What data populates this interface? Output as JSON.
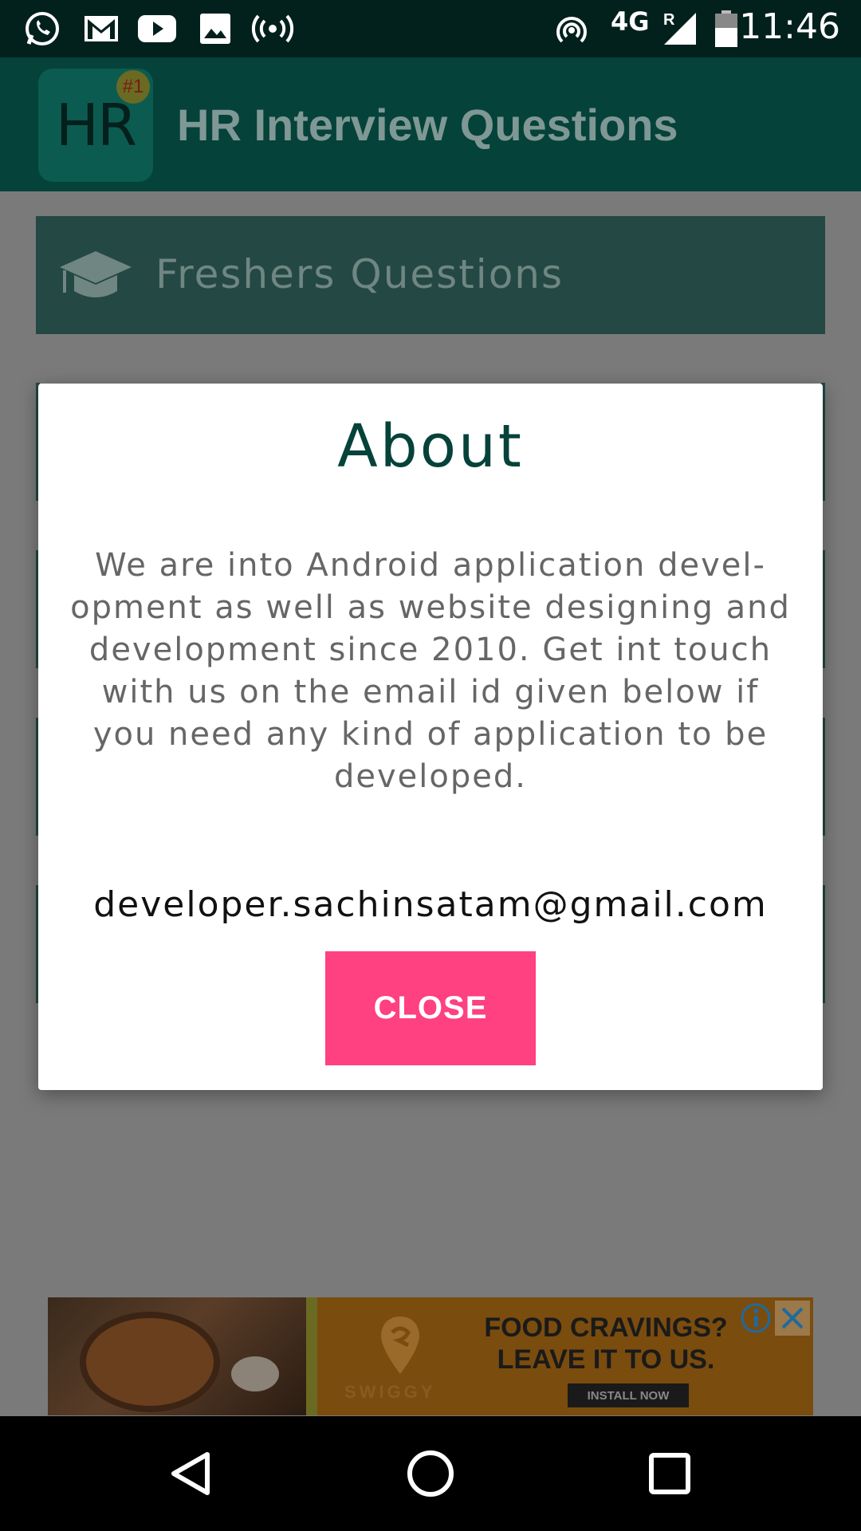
{
  "status_bar": {
    "time": "11:46",
    "network": "4G",
    "roaming": "R",
    "icons": [
      "whatsapp-icon",
      "gmail-icon",
      "youtube-icon",
      "gallery-icon",
      "hotspot-icon",
      "wifi-tethering-icon",
      "signal-icon",
      "battery-icon"
    ]
  },
  "app_bar": {
    "logo_text": "HR",
    "logo_badge": "#1",
    "title": "HR Interview Questions"
  },
  "background": {
    "cards": [
      {
        "label": "Freshers Questions",
        "icon": "graduation-cap-icon"
      }
    ]
  },
  "dialog": {
    "title": "About",
    "body_lines": [
      "We are into Android application devel-",
      "opment as well as website designing and",
      "development since 2010. Get int touch",
      "with us on the email id given below if",
      "you need any kind of application to be",
      "developed."
    ],
    "email": "developer.sachinsatam@gmail.com",
    "close_label": "CLOSE"
  },
  "ad": {
    "brand": "SWIGGY",
    "headline_line1": "FOOD CRAVINGS?",
    "headline_line2": "LEAVE IT TO US.",
    "cta": "INSTALL NOW"
  },
  "colors": {
    "accent": "#ff4081",
    "primary_dark": "#05423a",
    "status_bar": "#03211c"
  }
}
